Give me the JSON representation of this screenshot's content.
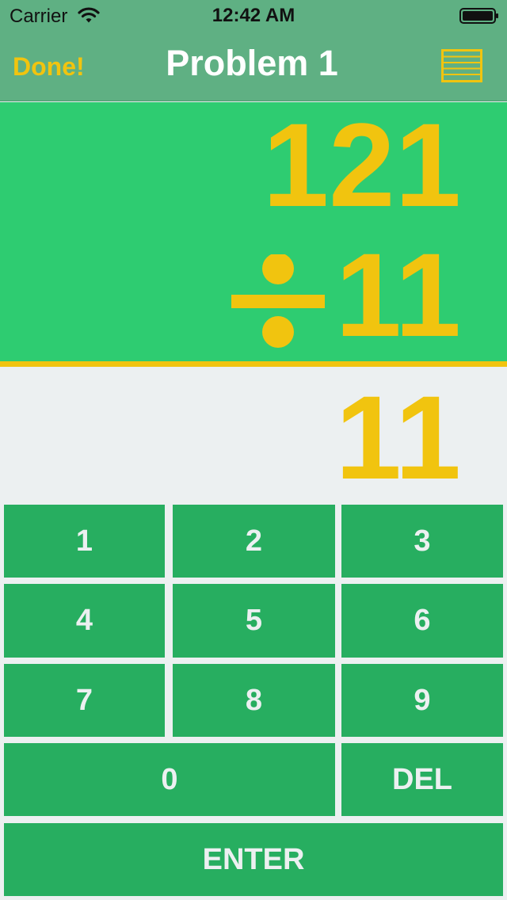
{
  "status_bar": {
    "carrier": "Carrier",
    "time": "12:42 AM"
  },
  "nav": {
    "done_label": "Done!",
    "title": "Problem 1",
    "right_icon": "list-icon"
  },
  "problem": {
    "operand1": "121",
    "operator": "÷",
    "operator_icon": "division-sign-icon",
    "operand2": "11"
  },
  "answer": {
    "value": "11"
  },
  "keypad": {
    "keys": [
      "1",
      "2",
      "3",
      "4",
      "5",
      "6",
      "7",
      "8",
      "9",
      "0",
      "DEL",
      "ENTER"
    ]
  },
  "colors": {
    "nav_background": "#5fb083",
    "accent_yellow": "#f1c40f",
    "problem_background": "#2ecc71",
    "key_background": "#27ae60",
    "answer_background": "#ecf0f1"
  }
}
